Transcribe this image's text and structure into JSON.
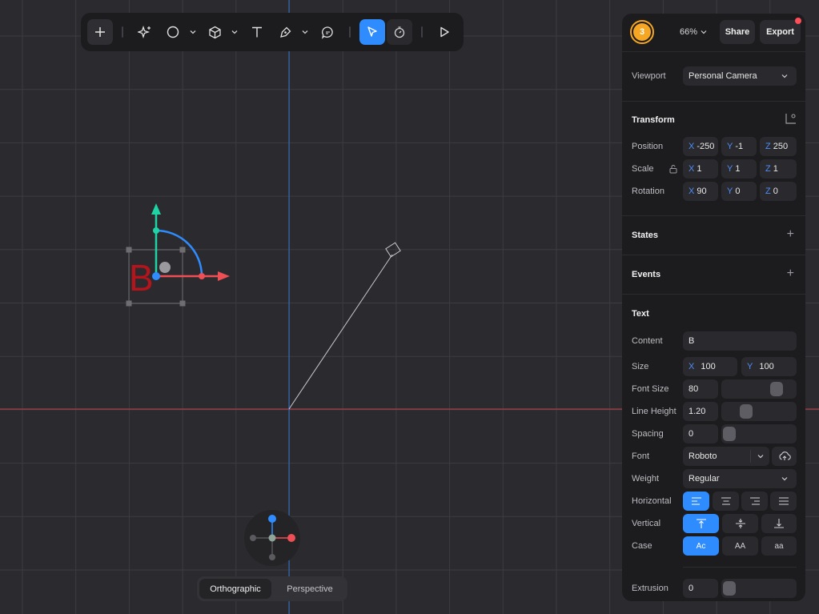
{
  "canvas": {
    "grid_color": "#3c3c41",
    "x_axis_color": "#c0404a",
    "y_axis_color": "#2f6fd0",
    "object_text": "B",
    "object_color": "#b5141c",
    "gizmo_x_color": "#ee4f55",
    "gizmo_y_color": "#1fd3a4",
    "gizmo_z_color": "#2f8cff"
  },
  "toolbar": {
    "tools": [
      "add-icon",
      "ai-sparkle-icon",
      "ellipse-icon",
      "cube-icon",
      "text-icon",
      "pen-icon",
      "comment-icon",
      "select-cursor-icon",
      "timer-icon",
      "play-icon"
    ],
    "active_tool": "select-cursor-icon",
    "accent": "#2f8cff"
  },
  "header": {
    "user_count": "3",
    "zoom": "66%",
    "share_label": "Share",
    "export_label": "Export"
  },
  "viewport": {
    "label": "Viewport",
    "value": "Personal Camera"
  },
  "transform": {
    "title": "Transform",
    "position": {
      "label": "Position",
      "x": "-250",
      "y": "-1",
      "z": "250"
    },
    "scale": {
      "label": "Scale",
      "x": "1",
      "y": "1",
      "z": "1"
    },
    "rotation": {
      "label": "Rotation",
      "x": "90",
      "y": "0",
      "z": "0"
    },
    "axis_x": "X",
    "axis_y": "Y",
    "axis_z": "Z"
  },
  "states": {
    "title": "States"
  },
  "events": {
    "title": "Events"
  },
  "text": {
    "title": "Text",
    "content": {
      "label": "Content",
      "value": "B"
    },
    "size": {
      "label": "Size",
      "x": "100",
      "y": "100"
    },
    "font_size": {
      "label": "Font Size",
      "value": "80",
      "slider": 0.8
    },
    "line_height": {
      "label": "Line Height",
      "value": "1.20",
      "slider": 0.28
    },
    "spacing": {
      "label": "Spacing",
      "value": "0",
      "slider": 0
    },
    "font": {
      "label": "Font",
      "value": "Roboto"
    },
    "weight": {
      "label": "Weight",
      "value": "Regular"
    },
    "horizontal": {
      "label": "Horizontal",
      "options": [
        "align-left-icon",
        "align-center-icon",
        "align-right-icon",
        "align-justify-icon"
      ],
      "active": 0
    },
    "vertical": {
      "label": "Vertical",
      "options": [
        "align-top-icon",
        "align-middle-icon",
        "align-bottom-icon"
      ],
      "active": 0
    },
    "case": {
      "label": "Case",
      "options": [
        "Ac",
        "AA",
        "aa"
      ],
      "active": 0
    },
    "extrusion": {
      "label": "Extrusion",
      "value": "0",
      "slider": 0
    }
  },
  "view_mode": {
    "options": [
      "Orthographic",
      "Perspective"
    ],
    "active": "Orthographic"
  }
}
